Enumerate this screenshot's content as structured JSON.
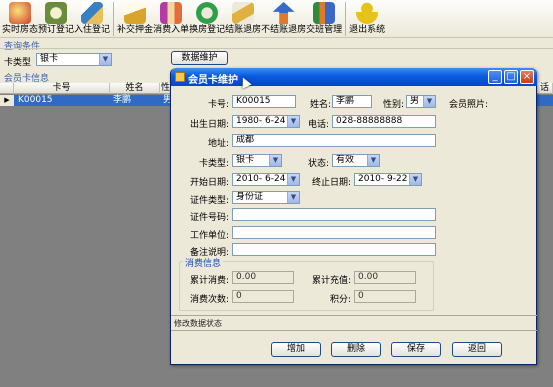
{
  "toolbar": {
    "items": [
      {
        "label": "实时房态",
        "icon": "house-status-icon",
        "color": "#d23a2a"
      },
      {
        "label": "预订登记",
        "icon": "reservation-icon",
        "color": "#6b8c3a"
      },
      {
        "label": "入住登记",
        "icon": "checkin-icon",
        "color": "#3a7fc2"
      },
      {
        "label": "补交押金",
        "icon": "deposit-icon",
        "color": "#d8a52a"
      },
      {
        "label": "消费入单",
        "icon": "consumption-icon",
        "color": "#b63aa4"
      },
      {
        "label": "换房登记",
        "icon": "change-room-icon",
        "color": "#2fa04a"
      },
      {
        "label": "结账退房",
        "icon": "checkout-icon",
        "color": "#e0b040"
      },
      {
        "label": "不结账退房",
        "icon": "no-pay-checkout-icon",
        "color": "#3a68c8"
      },
      {
        "label": "交班管理",
        "icon": "shift-icon",
        "color": "#e07a2a"
      },
      {
        "label": "退出系统",
        "icon": "exit-icon",
        "color": "#e6c21a"
      }
    ]
  },
  "query": {
    "section_title": "查询条件",
    "card_type_label": "卡类型",
    "card_type_value": "银卡",
    "maintain_button": "数据维护"
  },
  "member_info": {
    "section_title": "会员卡信息",
    "columns": [
      "卡号",
      "姓名",
      "性",
      "话"
    ],
    "rows": [
      {
        "card_no": "K00015",
        "name": "李鹏",
        "gender": "男"
      }
    ]
  },
  "dialog": {
    "title": "会员卡维护",
    "labels": {
      "card_no": "卡号:",
      "name": "姓名:",
      "gender": "性别:",
      "photo": "会员照片:",
      "birthday": "出生日期:",
      "phone": "电话:",
      "address": "地址:",
      "card_type": "卡类型:",
      "status": "状态:",
      "start_date": "开始日期:",
      "end_date": "终止日期:",
      "id_type": "证件类型:",
      "id_no": "证件号码:",
      "work_unit": "工作单位:",
      "remark": "备注说明:",
      "consume_group": "消费信息",
      "total_consume": "累计消费:",
      "total_recharge": "累计充值:",
      "consume_count": "消费次数:",
      "points": "积分:"
    },
    "values": {
      "card_no": "K00015",
      "name": "李鹏",
      "gender": "男",
      "birthday": "1980- 6-24",
      "phone": "028-88888888",
      "address": "成都",
      "card_type": "银卡",
      "status": "有效",
      "start_date": "2010- 6-24",
      "end_date": "2010- 9-22",
      "id_type": "身份证",
      "id_no": "",
      "work_unit": "",
      "remark": "",
      "total_consume": "0.00",
      "total_recharge": "0.00",
      "consume_count": "0",
      "points": "0"
    },
    "status_text": "修改数据状态",
    "buttons": {
      "add": "增加",
      "delete": "删除",
      "save": "保存",
      "back": "返回"
    }
  }
}
